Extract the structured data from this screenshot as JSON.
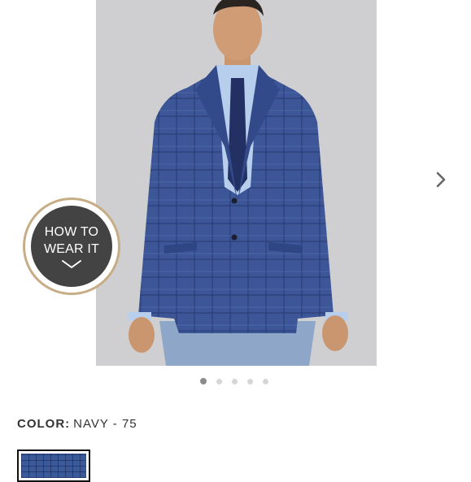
{
  "product": {
    "image_subject": "man-in-navy-plaid-sport-coat"
  },
  "how_to_wear": {
    "line1": "HOW TO",
    "line2": "WEAR IT",
    "icon": "chevron-down-icon"
  },
  "carousel": {
    "slide_count": 5,
    "active_index": 0,
    "next_icon": "chevron-right-icon"
  },
  "color": {
    "label": "COLOR:",
    "value": "NAVY - 75"
  },
  "swatch": {
    "color": "#3b5a9a"
  },
  "colors": {
    "photo_background": "#cfcfd1",
    "badge_ring": "#c7ad85",
    "badge_fill": "#434343",
    "dot_active": "#8b8b8b",
    "dot_inactive": "#d6d6d6"
  }
}
